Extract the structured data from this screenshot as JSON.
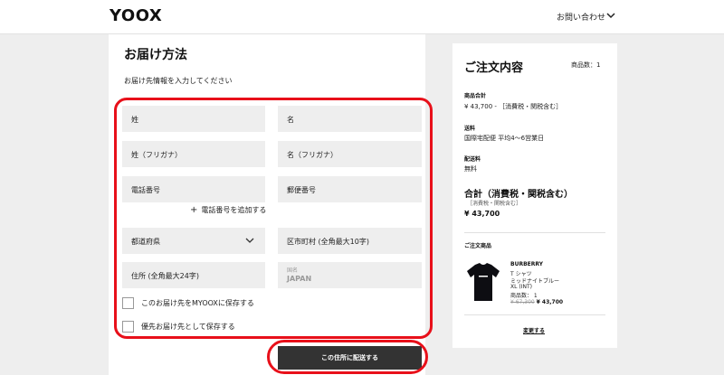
{
  "header": {
    "logo": "YOOX",
    "contact_label": "お問い合わせ"
  },
  "form": {
    "title": "お届け方法",
    "subtitle": "お届け先情報を入力してください",
    "last_name_placeholder": "姓",
    "first_name_placeholder": "名",
    "last_name_kana_placeholder": "姓（フリガナ）",
    "first_name_kana_placeholder": "名（フリガナ）",
    "phone_placeholder": "電話番号",
    "postal_placeholder": "郵便番号",
    "add_phone_label": "電話番号を追加する",
    "prefecture_placeholder": "都道府県",
    "city_placeholder": "区市町村 (全角最大10字)",
    "address_placeholder": "住所 (全角最大24字)",
    "country_label": "国名",
    "country_value": "JAPAN",
    "save_to_myoox_label": "このお届け先をMYOOXに保存する",
    "save_as_primary_label": "優先お届け先として保存する",
    "submit_label": "この住所に配送する"
  },
  "order": {
    "title": "ご注文内容",
    "item_count": "商品数：1",
    "subtotal_label": "商品合計",
    "subtotal_value": "¥ 43,700 - ［消費税・関税含む］",
    "shipping_label": "送料",
    "shipping_value": "国際宅配便 平均4〜6営業日",
    "shipping_fee_label": "配送料",
    "shipping_fee_value": "無料",
    "total_label": "合計（消費税・関税含む）",
    "total_sub": "［消費税・関税含む］",
    "total_value": "¥ 43,700",
    "items_heading": "ご注文商品",
    "product": {
      "brand": "BURBERRY",
      "type": "T シャツ",
      "color": "ミッドナイトブルー",
      "size": "XL (INT)",
      "quantity": "商品数： 1",
      "old_price": "¥ 67,300",
      "new_price": "¥ 43,700"
    },
    "change_label": "変更する"
  },
  "colors": {
    "highlight": "#e8101a",
    "button": "#333333",
    "field_bg": "#eeeeee"
  }
}
